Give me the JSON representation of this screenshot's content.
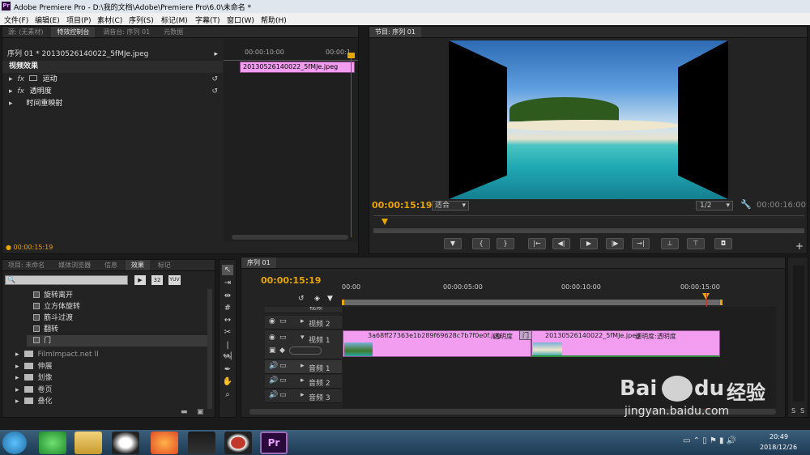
{
  "window": {
    "title": "Adobe Premiere Pro - D:\\我的文档\\Adobe\\Premiere Pro\\6.0\\未命名 *",
    "app_icon": "Pr"
  },
  "menu": [
    "文件(F)",
    "编辑(E)",
    "项目(P)",
    "素材(C)",
    "序列(S)",
    "标记(M)",
    "字幕(T)",
    "窗口(W)",
    "帮助(H)"
  ],
  "top_left_tabs": [
    "源: (无素材)",
    "特效控制台",
    "调音台: 序列 01",
    "元数据"
  ],
  "effect_controls": {
    "clip_header": "序列 01 * 20130526140022_5fMJe.jpeg",
    "section": "视频效果",
    "items": [
      "运动",
      "透明度",
      "时间重映射"
    ],
    "fx": "fx",
    "ruler_time": "00:00:10:00",
    "ruler_time2": "00:00:1",
    "mini_clip": "20130526140022_5fMJe.jpeg",
    "timecode": "00:00:15:19"
  },
  "program_monitor": {
    "tab": "节目: 序列 01",
    "timecode": "00:00:15:19",
    "fit": "适合",
    "resolution": "1/2",
    "duration": "00:00:16:00",
    "controls": [
      "marker",
      "in",
      "out",
      "go-in",
      "step-back",
      "play",
      "step-forward",
      "go-out",
      "lift",
      "extract",
      "export-frame"
    ]
  },
  "bottom_left_tabs": [
    "项目: 未命名",
    "媒体浏览器",
    "信息",
    "效果",
    "标记"
  ],
  "effects_panel": {
    "icon_buttons": [
      "32",
      "YUV"
    ],
    "effect_items": [
      "旋转离开",
      "立方体旋转",
      "筋斗过渡",
      "翻转",
      "门"
    ],
    "folders": [
      "FilmImpact.net II",
      "伸展",
      "划像",
      "卷页",
      "叠化"
    ]
  },
  "timeline": {
    "tab": "序列 01",
    "timecode": "00:00:15:19",
    "ruler": [
      "00:00",
      "00:00:05:00",
      "00:00:10:00",
      "00:00:15:00"
    ],
    "tracks": {
      "video3_partial": "视频",
      "video2": "视频 2",
      "video1": "视频 1",
      "audio1": "音频 1",
      "audio2": "音频 2",
      "audio3": "音频 3"
    },
    "clip1": {
      "name": "3a68ff27363e1b289f69628c7b7f0e0f.jpg",
      "effect": "透明度"
    },
    "transition": "门",
    "clip2": {
      "name": "20130526140022_5fMJe.jpeg",
      "effect": "透明度:透明度"
    },
    "scroll_labels": [
      "S",
      "S"
    ]
  },
  "taskbar": {
    "time": "20:49",
    "date": "2018/12/26",
    "pr_label": "Pr"
  },
  "watermark": {
    "brand": "Bai",
    "brand2": "du",
    "cn": "经验",
    "url": "jingyan.baidu.com"
  },
  "colors": {
    "accent": "#e8a400",
    "clip": "#f29df0",
    "playhead": "#c0392b"
  }
}
